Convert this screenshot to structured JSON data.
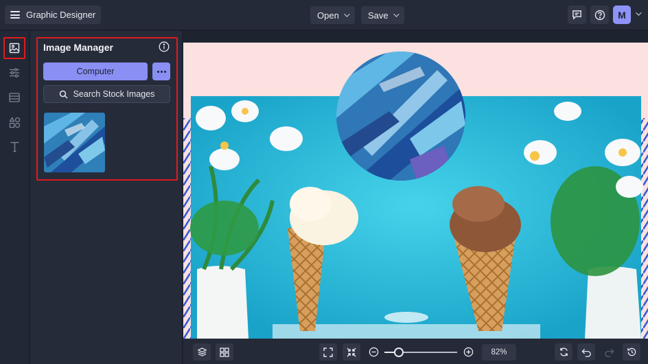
{
  "header": {
    "app_title": "Graphic Designer",
    "open_label": "Open",
    "save_label": "Save",
    "avatar_initial": "M"
  },
  "panel": {
    "title": "Image Manager",
    "computer_label": "Computer",
    "search_label": "Search Stock Images"
  },
  "zoom": {
    "percent_label": "82%",
    "slider_level": 0.2
  },
  "colors": {
    "accent": "#8a8ff3",
    "highlight_outline": "#e01b1b",
    "artboard_bg": "#fbe1e0",
    "photo_bg": "#1fb3d4"
  },
  "icons": {
    "rail": [
      "image-icon",
      "sliders-icon",
      "layout-icon",
      "elements-icon",
      "text-icon"
    ],
    "top_right": [
      "comment-icon",
      "help-icon"
    ],
    "bottom": [
      "layers-icon",
      "grid-icon",
      "fit-screen-icon",
      "shrink-icon",
      "zoom-out-icon",
      "zoom-in-icon",
      "refresh-icon",
      "undo-icon",
      "redo-icon",
      "history-icon"
    ]
  }
}
